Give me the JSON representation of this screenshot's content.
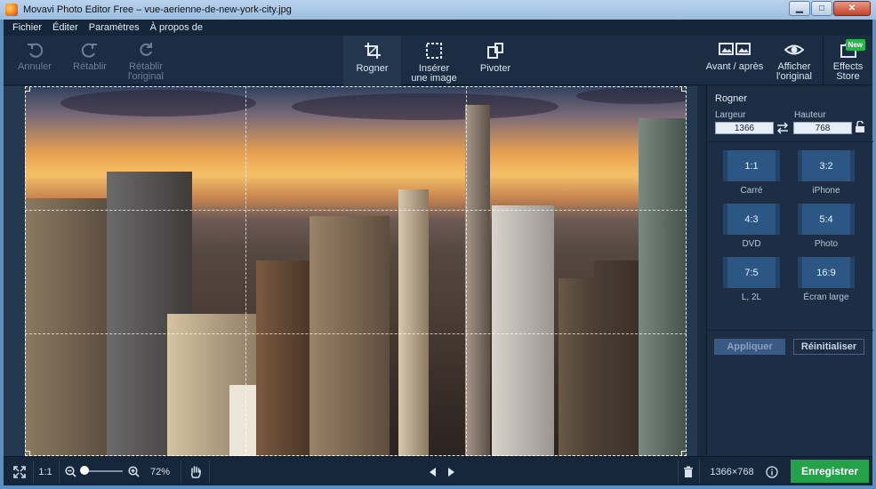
{
  "window": {
    "title": "Movavi Photo Editor Free – vue-aerienne-de-new-york-city.jpg",
    "minimize": "▁",
    "maximize": "□",
    "close": "✕"
  },
  "menu": [
    "Fichier",
    "Éditer",
    "Paramètres",
    "À propos de"
  ],
  "toolbar": {
    "undo": "Annuler",
    "redo": "Rétablir",
    "revert": "Rétablir\nl'original",
    "crop": "Rogner",
    "insert": "Insérer\nune image",
    "rotate": "Pivoter",
    "before_after": "Avant / après",
    "show_original": "Afficher\nl'original",
    "effects_store": "Effects\nStore",
    "new_badge": "New"
  },
  "panel": {
    "title": "Rogner",
    "width_label": "Largeur",
    "height_label": "Hauteur",
    "width_value": "1366",
    "height_value": "768",
    "ratios": [
      {
        "ratio": "1:1",
        "name": "Carré"
      },
      {
        "ratio": "3:2",
        "name": "iPhone"
      },
      {
        "ratio": "4:3",
        "name": "DVD"
      },
      {
        "ratio": "5:4",
        "name": "Photo"
      },
      {
        "ratio": "7:5",
        "name": "L, 2L"
      },
      {
        "ratio": "16:9",
        "name": "Écran large"
      }
    ],
    "apply": "Appliquer",
    "reset": "Réinitialiser"
  },
  "status": {
    "one_to_one": "1:1",
    "zoom": "72%",
    "zoom_fraction": 0.05,
    "dimensions": "1366×768",
    "save": "Enregistrer"
  },
  "icons": {
    "fit": "expand-icon",
    "zoom_out": "zoom-out-icon",
    "zoom_in": "zoom-in-icon",
    "hand": "hand-icon",
    "prev": "prev-arrow-icon",
    "next": "next-arrow-icon",
    "trash": "trash-icon",
    "info": "info-icon"
  },
  "colors": {
    "accent_save": "#23a24a",
    "panel_bg": "#1d2e44",
    "ratio_btn": "#2c5784"
  }
}
